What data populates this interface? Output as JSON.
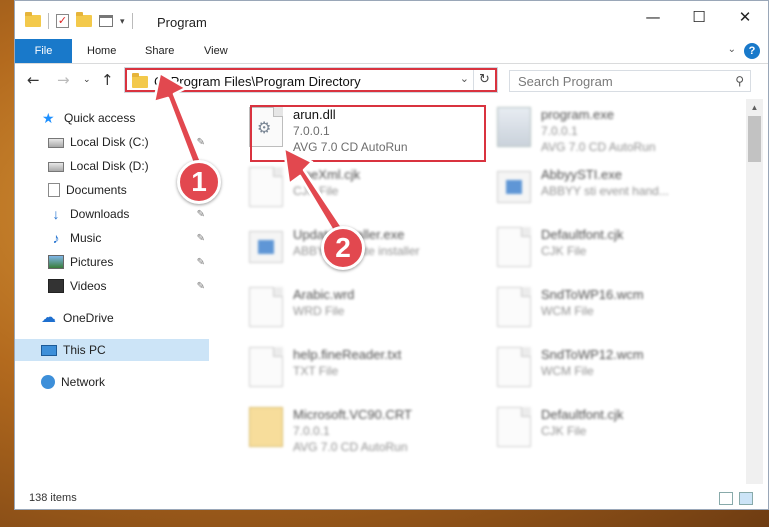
{
  "window": {
    "title": "Program",
    "controls": {
      "minimize": "—",
      "maximize": "☐",
      "close": "✕"
    }
  },
  "ribbon": {
    "tabs": [
      {
        "label": "File"
      },
      {
        "label": "Home"
      },
      {
        "label": "Share"
      },
      {
        "label": "View"
      }
    ],
    "accent": "#1979ca"
  },
  "address": {
    "path": "C:\\Program Files\\Program Directory",
    "highlight_color": "#d9333f"
  },
  "search": {
    "placeholder": "Search Program"
  },
  "sidebar": {
    "items": [
      {
        "label": "Quick access",
        "icon": "star-icon",
        "pinned": false
      },
      {
        "label": "Local Disk (C:)",
        "icon": "disk-icon",
        "pinned": true
      },
      {
        "label": "Local Disk (D:)",
        "icon": "disk-icon",
        "pinned": true
      },
      {
        "label": "Documents",
        "icon": "document-icon",
        "pinned": true
      },
      {
        "label": "Downloads",
        "icon": "download-icon",
        "pinned": true
      },
      {
        "label": "Music",
        "icon": "music-icon",
        "pinned": true
      },
      {
        "label": "Pictures",
        "icon": "pictures-icon",
        "pinned": true
      },
      {
        "label": "Videos",
        "icon": "videos-icon",
        "pinned": true
      },
      {
        "label": "OneDrive",
        "icon": "cloud-icon",
        "pinned": false
      },
      {
        "label": "This PC",
        "icon": "computer-icon",
        "pinned": false,
        "selected": true
      },
      {
        "label": "Network",
        "icon": "network-icon",
        "pinned": false
      }
    ]
  },
  "files": [
    {
      "name": "arun.dll",
      "line2": "7.0.0.1",
      "line3": "AVG 7.0 CD AutoRun",
      "icon": "dll-gear-icon",
      "highlighted": true
    },
    {
      "name": "program.exe",
      "line2": "7.0.0.1",
      "line3": "AVG 7.0 CD AutoRun",
      "icon": "exe-icon"
    },
    {
      "name": "FineXml.cjk",
      "line2": "CJK File",
      "line3": "",
      "icon": "file-icon"
    },
    {
      "name": "AbbyySTI.exe",
      "line2": "ABBYY sti event hand...",
      "line3": "",
      "icon": "app-icon"
    },
    {
      "name": "UpdateInstaller.exe",
      "line2": "ABBYY Update installer",
      "line3": "",
      "icon": "app-icon"
    },
    {
      "name": "Defaultfont.cjk",
      "line2": "CJK File",
      "line3": "",
      "icon": "file-icon"
    },
    {
      "name": "Arabic.wrd",
      "line2": "WRD File",
      "line3": "",
      "icon": "file-icon"
    },
    {
      "name": "SndToWP16.wcm",
      "line2": "WCM File",
      "line3": "",
      "icon": "file-icon"
    },
    {
      "name": "help.fineReader.txt",
      "line2": "TXT File",
      "line3": "",
      "icon": "file-icon"
    },
    {
      "name": "SndToWP12.wcm",
      "line2": "WCM File",
      "line3": "",
      "icon": "file-icon"
    },
    {
      "name": "Microsoft.VC90.CRT",
      "line2": "7.0.0.1",
      "line3": "AVG 7.0 CD AutoRun",
      "icon": "vc-icon"
    },
    {
      "name": "Defaultfont.cjk",
      "line2": "CJK File",
      "line3": "",
      "icon": "file-icon"
    }
  ],
  "status": {
    "item_count": "138 items"
  },
  "annotations": [
    {
      "number": "1",
      "color": "#e2484f"
    },
    {
      "number": "2",
      "color": "#e2484f"
    }
  ]
}
